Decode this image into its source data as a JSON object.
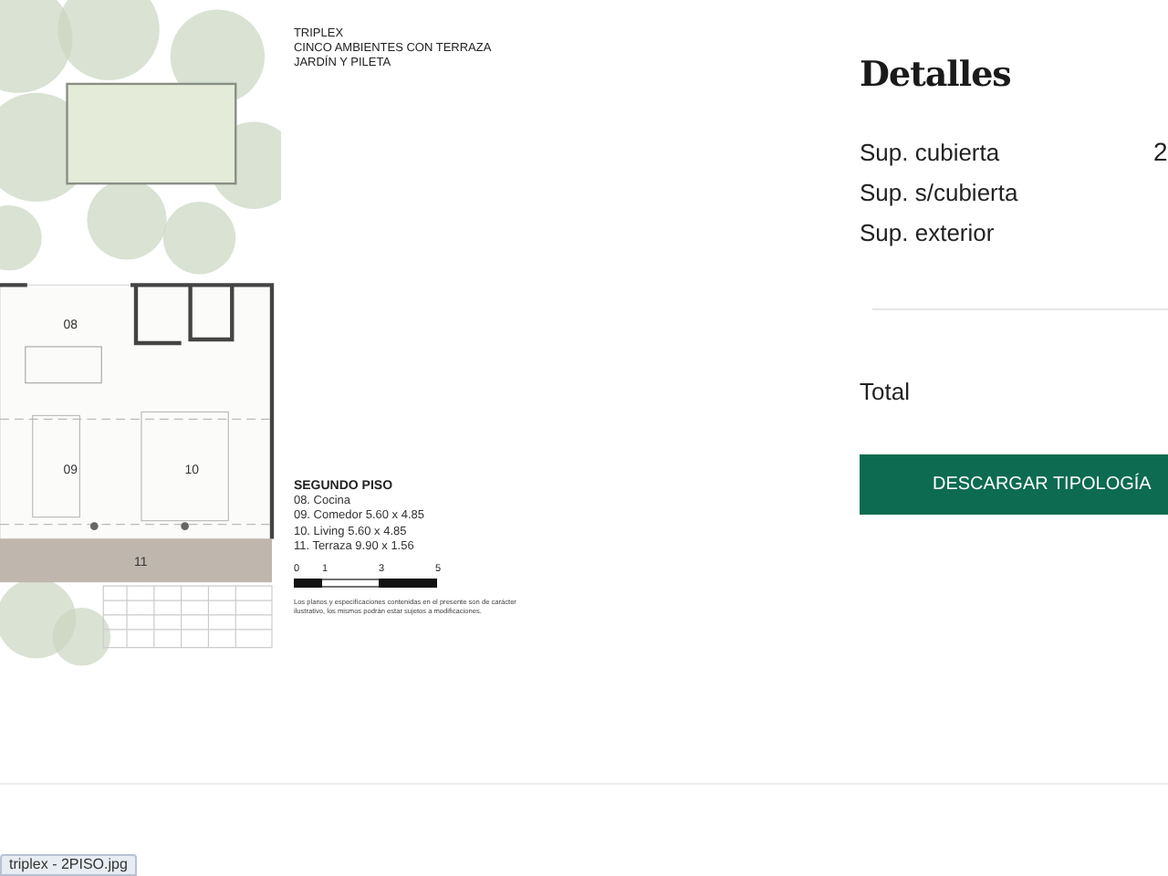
{
  "plan": {
    "title_lines": [
      "TRIPLEX",
      "CINCO AMBIENTES CON TERRAZA",
      "JARDÍN Y PILETA"
    ],
    "rooms": [
      {
        "label": "08"
      },
      {
        "label": "09"
      },
      {
        "label": "10"
      },
      {
        "label": "11"
      }
    ],
    "floor": "SEGUNDO PISO",
    "legend": [
      "08. Cocina",
      "09. Comedor 5.60 x 4.85",
      "10. Living 5.60 x 4.85",
      "11. Terraza 9.90 x 1.56"
    ],
    "scale_ticks": [
      "0",
      "1",
      "3",
      "5"
    ],
    "disclaimer": "Los planos y especificaciones contenidas en el presente son de carácter ilustrativo, los mismos podrán estar sujetos a modificaciones."
  },
  "details": {
    "heading": "Detalles",
    "rows": [
      {
        "label": "Sup. cubierta",
        "value": "2"
      },
      {
        "label": "Sup. s/cubierta"
      },
      {
        "label": "Sup. exterior"
      }
    ],
    "total_label": "Total",
    "button": "DESCARGAR TIPOLOGÍA"
  },
  "status_tooltip": "triplex - 2PISO.jpg"
}
